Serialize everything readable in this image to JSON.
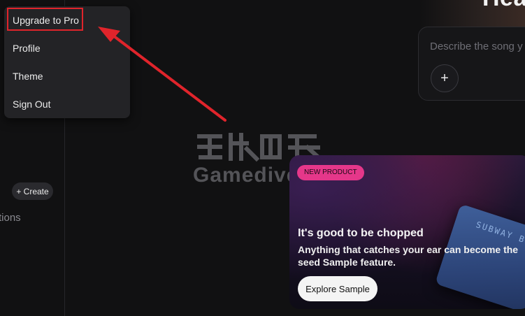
{
  "header": {
    "title": "Hea"
  },
  "prompt": {
    "placeholder": "Describe the song y",
    "add_label": "+"
  },
  "menu": {
    "items": [
      {
        "label": "Upgrade to Pro"
      },
      {
        "label": "Profile"
      },
      {
        "label": "Theme"
      },
      {
        "label": "Sign Out"
      }
    ]
  },
  "sidebar": {
    "create_label": "+ Create",
    "partial_label": "tions"
  },
  "watermark": {
    "text": "Gamediver"
  },
  "promo": {
    "badge": "NEW PRODUCT",
    "title": "It's good to be chopped",
    "description": "Anything that catches your ear can become the seed Sample feature.",
    "button_label": "Explore Sample",
    "ticket_text": "SUBWAY B"
  },
  "colors": {
    "background": "#111112",
    "annotation_red": "#e0242b",
    "badge_pink": "#e5378a"
  }
}
